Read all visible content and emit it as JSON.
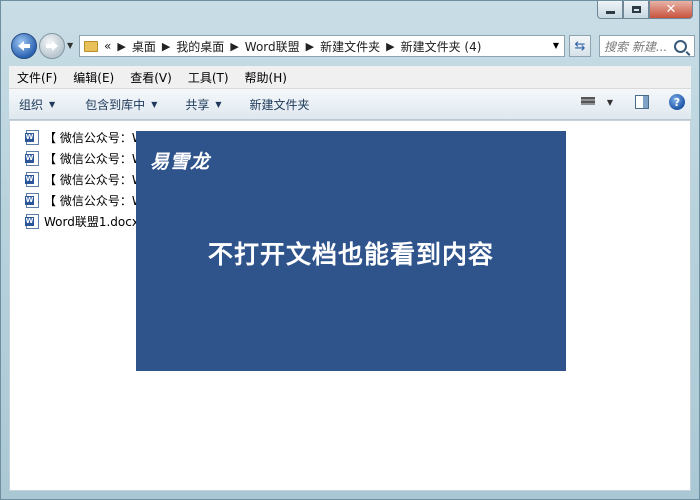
{
  "window": {
    "close_glyph": "✕"
  },
  "nav": {
    "breadcrumbs": [
      "«",
      "桌面",
      "我的桌面",
      "Word联盟",
      "新建文件夹",
      "新建文件夹 (4)"
    ],
    "search_placeholder": "搜索 新建..."
  },
  "menubar": {
    "items": [
      "文件(F)",
      "编辑(E)",
      "查看(V)",
      "工具(T)",
      "帮助(H)"
    ]
  },
  "toolbar": {
    "organize": "组织",
    "include_in_library": "包含到库中",
    "share": "共享",
    "new_folder": "新建文件夹",
    "help_glyph": "?"
  },
  "files": [
    {
      "name": "【 微信公众号：W",
      "icon": "word-doc-icon"
    },
    {
      "name": "【 微信公众号：W",
      "icon": "word-doc-icon"
    },
    {
      "name": "【 微信公众号：W",
      "icon": "word-doc-icon"
    },
    {
      "name": "【 微信公众号：W",
      "icon": "word-doc-icon"
    },
    {
      "name": "Word联盟1.docx",
      "icon": "word-doc-icon"
    }
  ],
  "banner": {
    "author": "易雪龙",
    "title": "不打开文档也能看到内容",
    "background": "#2f538b"
  }
}
